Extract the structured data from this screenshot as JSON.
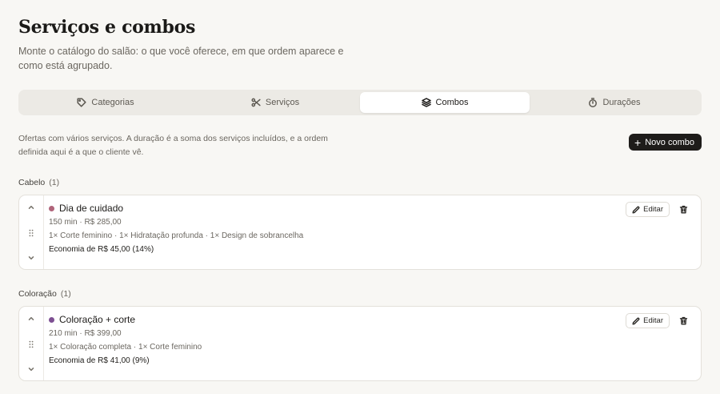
{
  "header": {
    "title": "Serviços e combos",
    "subtitle": "Monte o catálogo do salão: o que você oferece, em que ordem aparece e como está agrupado."
  },
  "tabs": [
    {
      "label": "Categorias",
      "icon": "tag-icon",
      "active": false
    },
    {
      "label": "Serviços",
      "icon": "scissors-icon",
      "active": false
    },
    {
      "label": "Combos",
      "icon": "layers-icon",
      "active": true
    },
    {
      "label": "Durações",
      "icon": "timer-icon",
      "active": false
    }
  ],
  "combos_section": {
    "description": "Ofertas com vários serviços. A duração é a soma dos serviços incluídos, e a ordem definida aqui é a que o cliente vê.",
    "new_button_label": "Novo combo"
  },
  "groups": [
    {
      "name": "Cabelo",
      "count": "(1)",
      "combos": [
        {
          "name": "Dia de cuidado",
          "color": "#b0647a",
          "meta": "150 min · R$ 285,00",
          "items": "1× Corte feminino · 1× Hidratação profunda · 1× Design de sobrancelha",
          "savings": "Economia de R$ 45,00 (14%)",
          "edit_label": "Editar"
        }
      ]
    },
    {
      "name": "Coloração",
      "count": "(1)",
      "combos": [
        {
          "name": "Coloração + corte",
          "color": "#7d4f92",
          "meta": "210 min · R$ 399,00",
          "items": "1× Coloração completa · 1× Corte feminino",
          "savings": "Economia de R$ 41,00 (9%)",
          "edit_label": "Editar"
        }
      ]
    }
  ]
}
